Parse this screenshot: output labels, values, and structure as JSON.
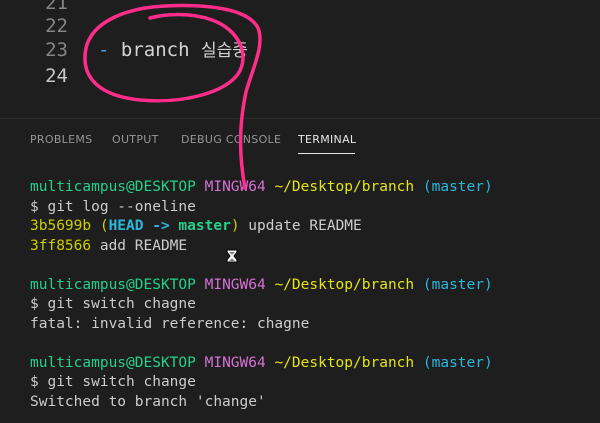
{
  "editor": {
    "lines": [
      {
        "number": "21",
        "text": ""
      },
      {
        "number": "22",
        "text": ""
      },
      {
        "number": "23",
        "dash": "-",
        "text": " branch ",
        "korean": "실습중"
      },
      {
        "number": "24",
        "text": ""
      }
    ]
  },
  "panel": {
    "tabs": [
      {
        "label": "PROBLEMS"
      },
      {
        "label": "OUTPUT"
      },
      {
        "label": "DEBUG CONSOLE"
      },
      {
        "label": "TERMINAL"
      }
    ]
  },
  "terminal": {
    "prompt": {
      "user": "multicampus@DESKTOP",
      "env": "MINGW64",
      "path": "~/Desktop/branch",
      "branch": "(master)"
    },
    "blocks": [
      {
        "command": "$ git log --oneline",
        "output": [
          {
            "hash": "3b5699b",
            "open": "(",
            "head": "HEAD -> ",
            "ref": "master",
            "close": ")",
            "msg": " update README"
          },
          {
            "hash": "3ff8566",
            "msg": " add README"
          }
        ]
      },
      {
        "command": "$ git switch chagne",
        "output_text": "fatal: invalid reference: chagne"
      },
      {
        "command": "$ git switch change",
        "output_text": "Switched to branch 'change'"
      }
    ]
  },
  "colors": {
    "annotation": "#ff2d8a",
    "prompt_user": "#23d18b",
    "prompt_env": "#d670d6",
    "prompt_path": "#e5e510",
    "prompt_branch": "#29b8db"
  },
  "icons": {
    "cursor": "wait-cursor-icon"
  }
}
